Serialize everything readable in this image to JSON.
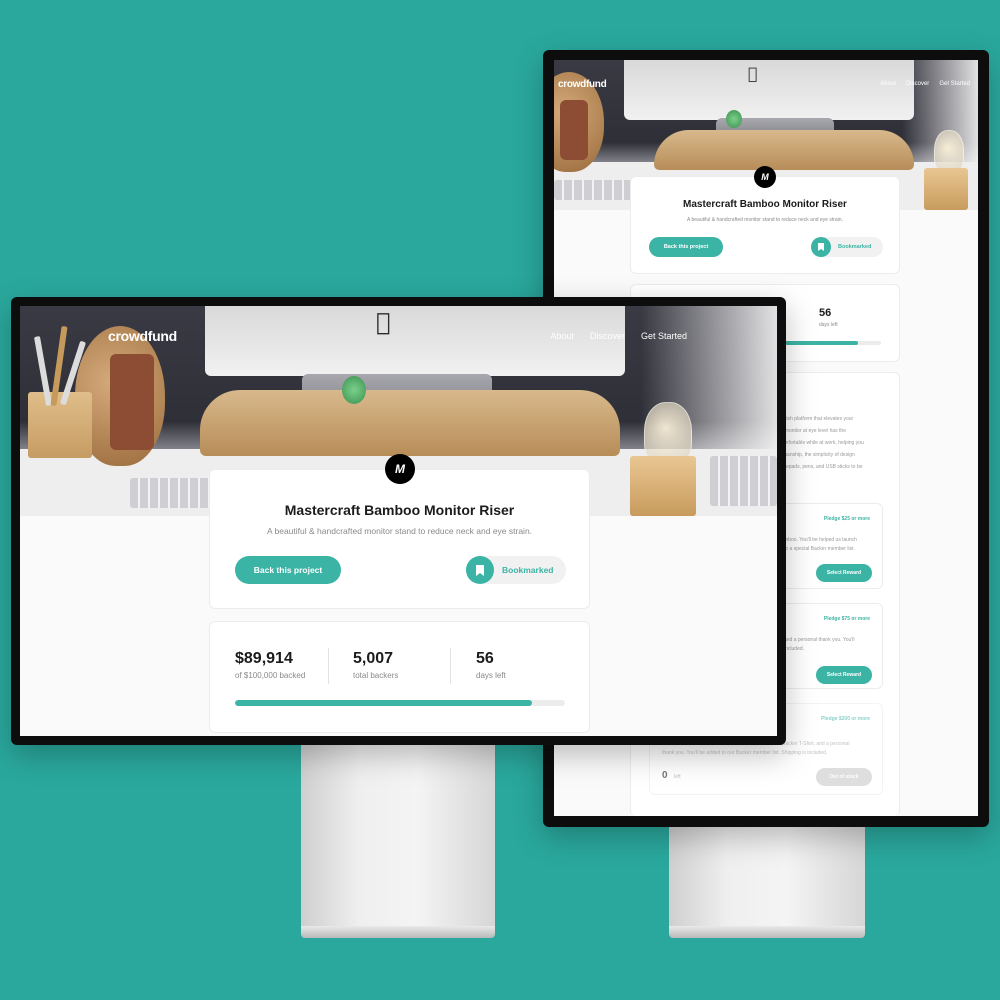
{
  "app": {
    "logo": "crowdfund",
    "nav": [
      "About",
      "Discover",
      "Get Started"
    ]
  },
  "project": {
    "title": "Mastercraft Bamboo Monitor Riser",
    "subtitle": "A beautiful & handcrafted monitor stand to reduce neck and eye strain.",
    "back_label": "Back this project",
    "bookmark_label": "Bookmarked",
    "logo_mark": "M"
  },
  "stats": {
    "backed": {
      "value": "$89,914",
      "label": "of $100,000 backed"
    },
    "backers": {
      "value": "5,007",
      "label": "total backers"
    },
    "days": {
      "value": "56",
      "label": "days left"
    },
    "progress_fraction": 0.8991
  },
  "back_monitor_partial": {
    "about_lines": [
      "stylish platform that elevates your",
      "ur monitor at eye level has the",
      "comfortable while at work, helping you",
      "tsmanship, the simplicity of design",
      "notepads, pens, and USB sticks to be"
    ],
    "rewards": [
      {
        "pledge": "Pledge $25 or more",
        "lines": [
          "mboo. You'll be helped us launch",
          "to a special Backer member list."
        ],
        "button": "Select Reward"
      },
      {
        "pledge": "Pledge $75 or more",
        "lines": [
          "and a personal thank you. You'll",
          "included."
        ],
        "button": "Select Reward"
      },
      {
        "pledge": "Pledge $200 or more",
        "lines": [
          "Backer T-Shirt, and a personal",
          "thank you. You'll be added to our Backer member list. Shipping is included."
        ],
        "left_count": "0",
        "left_label": "left",
        "button": "Out of stock"
      }
    ]
  },
  "colors": {
    "background": "#2aa89d",
    "accent": "#3cb4a5"
  },
  "icons": {
    "bookmark": "bookmark-icon",
    "apple": "apple-logo-icon",
    "brand": "mastercraft-logo-icon"
  }
}
